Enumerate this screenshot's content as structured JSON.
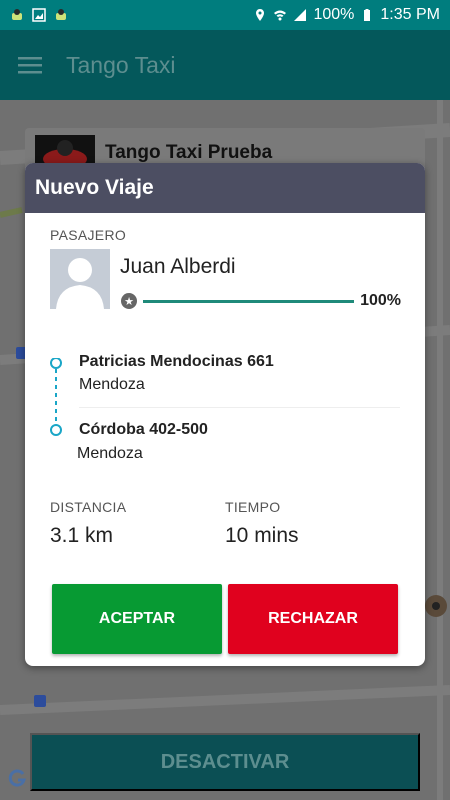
{
  "status_bar": {
    "battery": "100%",
    "time": "1:35 PM"
  },
  "app_bar": {
    "title": "Tango Taxi"
  },
  "background_card": {
    "title": "Tango Taxi Prueba"
  },
  "dialog": {
    "title": "Nuevo Viaje",
    "passenger_label": "PASAJERO",
    "passenger_name": "Juan Alberdi",
    "rating": 1.0,
    "rating_text": "100%",
    "origin": {
      "street": "Patricias Mendocinas 661",
      "city": "Mendoza"
    },
    "destination": {
      "street": "Córdoba 402-500",
      "city": "Mendoza"
    },
    "distance_label": "DISTANCIA",
    "distance_value": "3.1 km",
    "time_label": "TIEMPO",
    "time_value": "10 mins",
    "accept_label": "ACEPTAR",
    "reject_label": "RECHAZAR"
  },
  "footer": {
    "deactivate_label": "DESACTIVAR"
  },
  "colors": {
    "status_bar": "#007d7e",
    "app_bar": "#04585b",
    "dialog_header": "#4c4e62",
    "accept": "#079a33",
    "reject": "#e0011e",
    "route": "#1aa6c7"
  }
}
